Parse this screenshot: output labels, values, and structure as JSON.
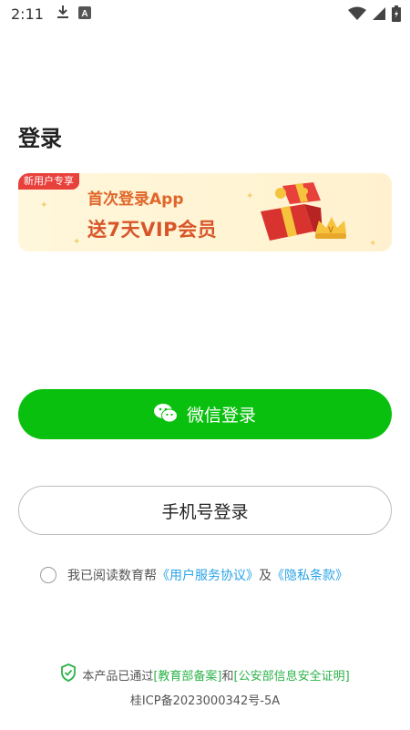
{
  "status_bar": {
    "time": "2:11",
    "icons": [
      "download-icon",
      "a-box-icon",
      "wifi-icon",
      "signal-icon",
      "battery-icon"
    ]
  },
  "page": {
    "title": "登录"
  },
  "banner": {
    "badge": "新用户专享",
    "line1": "首次登录App",
    "line2": "送7天VIP会员"
  },
  "buttons": {
    "wechat_label": "微信登录",
    "phone_label": "手机号登录"
  },
  "agreement": {
    "prefix": "我已阅读数育帮",
    "user_agreement": "《用户服务协议》",
    "conjunction": "及",
    "privacy": "《隐私条款》"
  },
  "footer": {
    "prefix": "本产品已通过",
    "edu_record": "[教育部备案]",
    "and": "和",
    "security_cert": "[公安部信息安全证明]",
    "icp": "桂ICP备2023000342号-5A"
  },
  "colors": {
    "wechat_green": "#0ac00e",
    "link_blue": "#2aa3e8",
    "footer_green": "#2cb34a",
    "badge_red": "#e8413c"
  }
}
